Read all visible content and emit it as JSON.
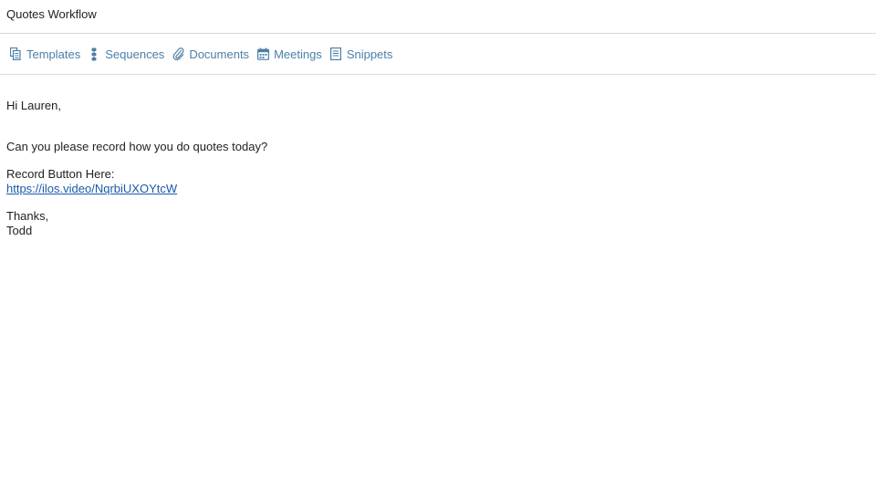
{
  "subject": "Quotes Workflow",
  "toolbar": {
    "items": [
      {
        "label": "Templates",
        "icon": "templates-icon"
      },
      {
        "label": "Sequences",
        "icon": "sequences-icon"
      },
      {
        "label": "Documents",
        "icon": "paperclip-icon"
      },
      {
        "label": "Meetings",
        "icon": "calendar-icon"
      },
      {
        "label": "Snippets",
        "icon": "snippets-icon"
      }
    ],
    "accent_color": "#4b7fa8"
  },
  "email": {
    "greeting": "Hi Lauren,",
    "question": "Can you please record how you do quotes today?",
    "record_label": "Record Button Here:",
    "link": "https://ilos.video/NqrbiUXOYtcW",
    "signoff": "Thanks,",
    "signature": "Todd"
  }
}
